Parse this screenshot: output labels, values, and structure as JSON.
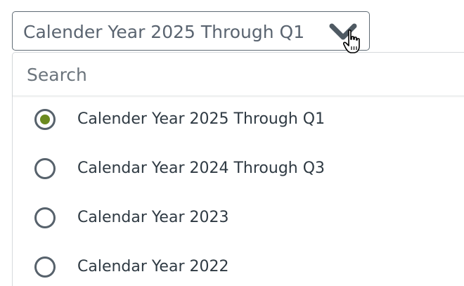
{
  "select": {
    "value": "Calender Year 2025 Through Q1",
    "icon": "chevron-down-icon"
  },
  "search": {
    "placeholder": "Search",
    "value": ""
  },
  "options": [
    {
      "label": "Calender Year 2025 Through Q1",
      "selected": true
    },
    {
      "label": "Calendar Year 2024 Through Q3",
      "selected": false
    },
    {
      "label": "Calendar Year 2023",
      "selected": false
    },
    {
      "label": "Calendar Year 2022",
      "selected": false
    }
  ],
  "colors": {
    "selected_dot": "#6b8a1f",
    "radio_border": "#56616b",
    "text": "#2f3a43",
    "muted_text": "#5a6470"
  }
}
